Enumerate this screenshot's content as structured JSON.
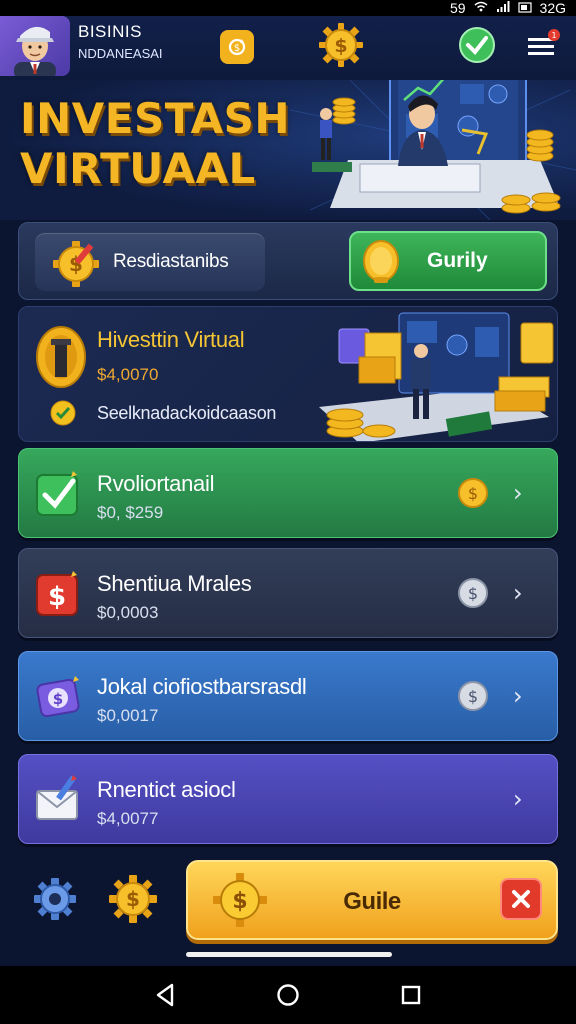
{
  "status_bar": {
    "left_number": "59",
    "time": "32G"
  },
  "profile": {
    "name": "BISINIS",
    "subtitle": "NDDANEASAI"
  },
  "hero": {
    "title_line1": "INVESTASH",
    "title_line2": "VIRTUAAL"
  },
  "actions": {
    "left_label": "Resdiastanibs",
    "right_label": "Gurily"
  },
  "featured": {
    "title": "Hivesttin Virtual",
    "price": "$4,0070",
    "description": "Seelknadackoidcaason"
  },
  "cards": [
    {
      "title": "Rvoliortanail",
      "value": "$0, $259",
      "color": "#2e9a52",
      "coin": "gold"
    },
    {
      "title": "Shentiua Mrales",
      "value": "$0,0003",
      "color": "#2c3650",
      "coin": "silver"
    },
    {
      "title": "Jokal ciofiostbarsrasdl",
      "value": "$0,0017",
      "color": "#2f66b4",
      "coin": "silver"
    },
    {
      "title": "Rnentict asiocl",
      "value": "$4,0077",
      "color": "#4b45b0",
      "coin": "none"
    }
  ],
  "bottom": {
    "main_button_label": "Guile"
  },
  "colors": {
    "accent_gold": "#f4b625",
    "green": "#2e9a52",
    "background": "#0c1530",
    "close_red": "#e23a2a"
  }
}
